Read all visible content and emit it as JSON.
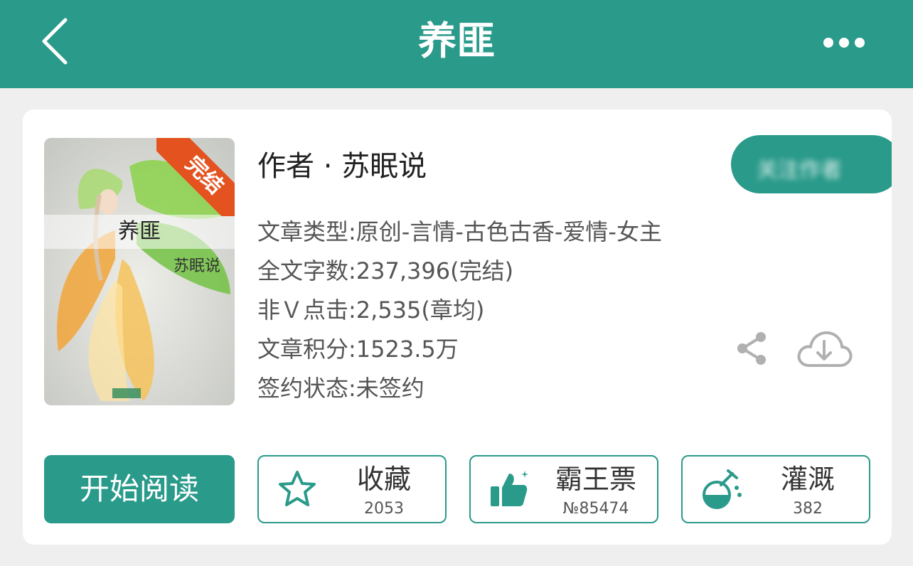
{
  "header": {
    "title": "养匪",
    "back_icon": "chevron-left-icon",
    "more_icon": "more-dots-icon",
    "background": "#2a9a8a"
  },
  "book": {
    "cover": {
      "title": "养匪",
      "author": "苏眠说",
      "status_ribbon": "完结",
      "ribbon_color": "#e4531f"
    },
    "author_line": "作者 · 苏眠说",
    "follow_button_label": "关注作者",
    "info": [
      "文章类型:原创-言情-古色古香-爱情-女主",
      "全文字数:237,396(完结)",
      "非Ｖ点击:2,535(章均)",
      "文章积分:1523.5万",
      "签约状态:未签约"
    ],
    "share_icon": "share-icon",
    "download_icon": "cloud-download-icon"
  },
  "actions": {
    "read_label": "开始阅读",
    "buttons": [
      {
        "label": "收藏",
        "count": "2053",
        "icon": "star-icon"
      },
      {
        "label": "霸王票",
        "count": "№85474",
        "icon": "thumbs-up-icon"
      },
      {
        "label": "灌溉",
        "count": "382",
        "icon": "flask-icon"
      }
    ]
  },
  "accent_color": "#2a9a8a"
}
